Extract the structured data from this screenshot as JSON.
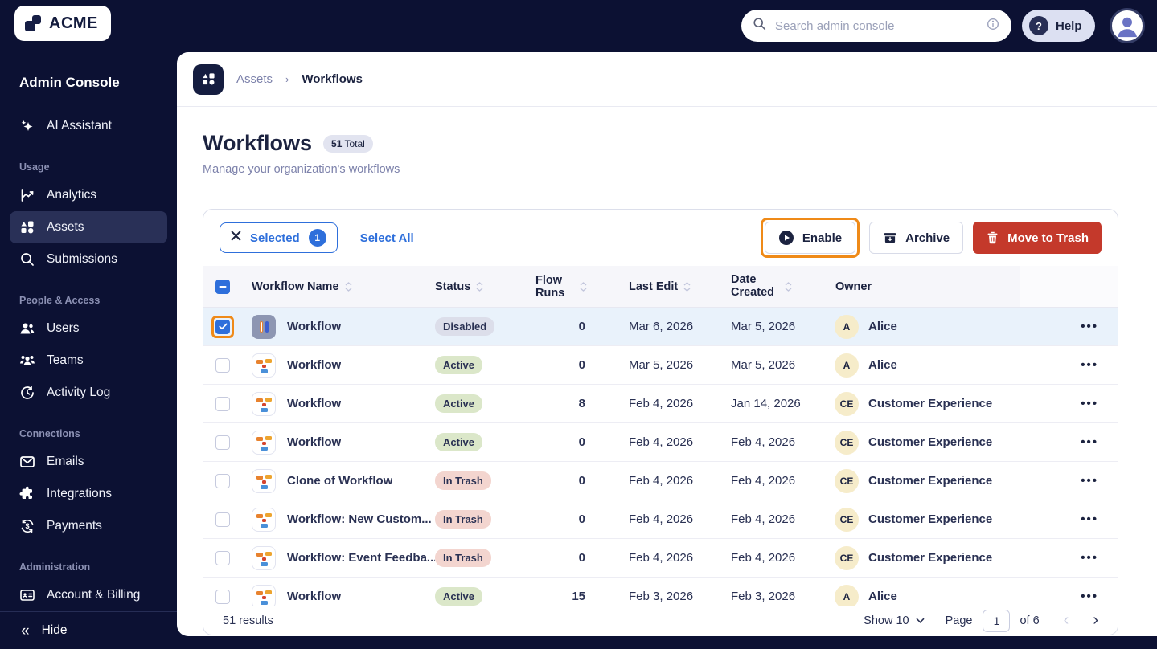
{
  "topbar": {
    "logo": "ACME",
    "search_placeholder": "Search admin console",
    "help_label": "Help"
  },
  "sidebar": {
    "title": "Admin Console",
    "ai_label": "AI Assistant",
    "sections": [
      {
        "label": "Usage",
        "items": [
          {
            "label": "Analytics"
          },
          {
            "label": "Assets",
            "active": true
          },
          {
            "label": "Submissions"
          }
        ]
      },
      {
        "label": "People & Access",
        "items": [
          {
            "label": "Users"
          },
          {
            "label": "Teams"
          },
          {
            "label": "Activity Log"
          }
        ]
      },
      {
        "label": "Connections",
        "items": [
          {
            "label": "Emails"
          },
          {
            "label": "Integrations"
          },
          {
            "label": "Payments"
          }
        ]
      },
      {
        "label": "Administration",
        "items": [
          {
            "label": "Account & Billing"
          }
        ]
      }
    ],
    "hide_label": "Hide"
  },
  "breadcrumb": {
    "parent": "Assets",
    "current": "Workflows"
  },
  "page": {
    "title": "Workflows",
    "badge_count": "51",
    "badge_label": "Total",
    "subtitle": "Manage your organization's workflows"
  },
  "toolbar": {
    "selected_label": "Selected",
    "selected_count": "1",
    "select_all_label": "Select All",
    "enable_label": "Enable",
    "archive_label": "Archive",
    "trash_label": "Move to Trash"
  },
  "table": {
    "columns": [
      {
        "label": "Workflow Name"
      },
      {
        "label": "Status"
      },
      {
        "label": "Flow Runs"
      },
      {
        "label": "Last Edit"
      },
      {
        "label": "Date Created"
      },
      {
        "label": "Owner"
      }
    ],
    "rows": [
      {
        "name": "Workflow",
        "icon": "workflow-paused",
        "status": "Disabled",
        "flow_runs": "0",
        "last_edit": "Mar 6, 2026",
        "date_created": "Mar 5, 2026",
        "owner_initials": "A",
        "owner_name": "Alice",
        "selected": true
      },
      {
        "name": "Workflow",
        "icon": "workflow",
        "status": "Active",
        "flow_runs": "0",
        "last_edit": "Mar 5, 2026",
        "date_created": "Mar 5, 2026",
        "owner_initials": "A",
        "owner_name": "Alice",
        "selected": false
      },
      {
        "name": "Workflow",
        "icon": "workflow",
        "status": "Active",
        "flow_runs": "8",
        "last_edit": "Feb 4, 2026",
        "date_created": "Jan 14, 2026",
        "owner_initials": "CE",
        "owner_name": "Customer Experience",
        "selected": false
      },
      {
        "name": "Workflow",
        "icon": "workflow",
        "status": "Active",
        "flow_runs": "0",
        "last_edit": "Feb 4, 2026",
        "date_created": "Feb 4, 2026",
        "owner_initials": "CE",
        "owner_name": "Customer Experience",
        "selected": false
      },
      {
        "name": "Clone of Workflow",
        "icon": "workflow",
        "status": "In Trash",
        "flow_runs": "0",
        "last_edit": "Feb 4, 2026",
        "date_created": "Feb 4, 2026",
        "owner_initials": "CE",
        "owner_name": "Customer Experience",
        "selected": false
      },
      {
        "name": "Workflow: New Custom...",
        "icon": "workflow",
        "status": "In Trash",
        "flow_runs": "0",
        "last_edit": "Feb 4, 2026",
        "date_created": "Feb 4, 2026",
        "owner_initials": "CE",
        "owner_name": "Customer Experience",
        "selected": false
      },
      {
        "name": "Workflow: Event Feedba...",
        "icon": "workflow",
        "status": "In Trash",
        "flow_runs": "0",
        "last_edit": "Feb 4, 2026",
        "date_created": "Feb 4, 2026",
        "owner_initials": "CE",
        "owner_name": "Customer Experience",
        "selected": false
      },
      {
        "name": "Workflow",
        "icon": "workflow",
        "status": "Active",
        "flow_runs": "15",
        "last_edit": "Feb 3, 2026",
        "date_created": "Feb 3, 2026",
        "owner_initials": "A",
        "owner_name": "Alice",
        "selected": false
      }
    ]
  },
  "pagination": {
    "results": "51 results",
    "show_label": "Show 10",
    "page_label": "Page",
    "page_value": "1",
    "of_label": "of 6"
  },
  "colors": {
    "navy": "#0c1133",
    "accent_blue": "#2e6fdb",
    "danger_red": "#c4392b",
    "annotation_orange": "#ef8a18",
    "badge_active_bg": "#dbe7c9",
    "badge_disabled_bg": "#dcdeea",
    "badge_trash_bg": "#f3d5cf"
  }
}
